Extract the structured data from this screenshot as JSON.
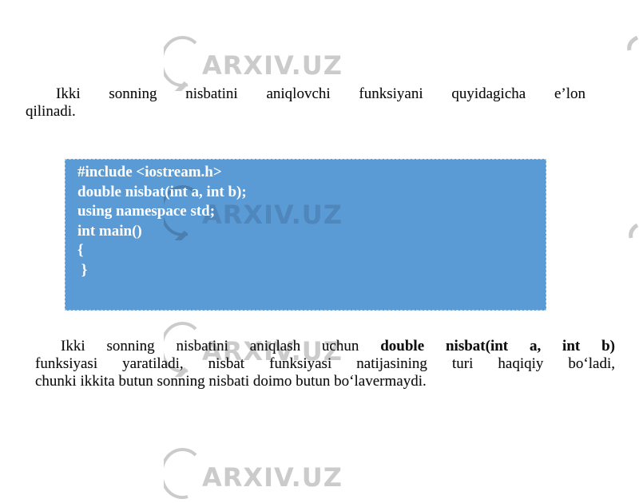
{
  "watermark": {
    "text": "ARXIV.UZ",
    "color": "#c9c9c9"
  },
  "paragraph1": {
    "lines": [
      "Ikki sonning nisbatini aniqlovchi funksiyani quyidagicha e’lon",
      "qilinadi."
    ]
  },
  "code_box": {
    "background": "#5b9bd5",
    "lines": [
      "#include <iostream.h>",
      "double nisbat(int a, int b);",
      "using namespace std;",
      "int main()",
      "{",
      " }"
    ]
  },
  "paragraph2": {
    "line1_prefix": "Ikki sonning nisbatini aniqlash uchun ",
    "line1_code": "double nisbat(int a, int b)",
    "line2": "funksiyasi yaratiladi, nisbat funksiyasi natijasining turi haqiqiy bo‘ladi,",
    "line3": "chunki ikkita butun sonning nisbati doimo butun bo‘lavermaydi."
  }
}
